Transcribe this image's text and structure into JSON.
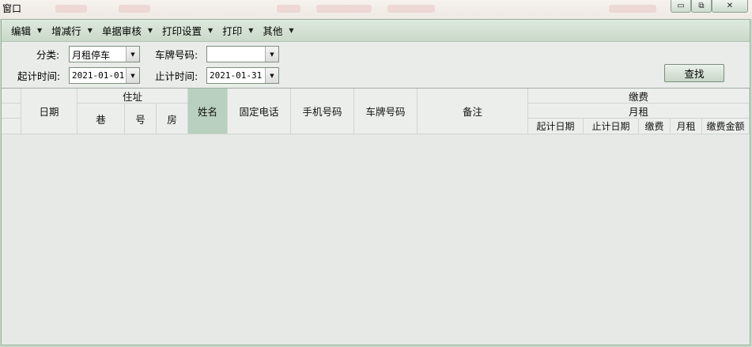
{
  "window": {
    "title": "窗口",
    "minimize_glyph": "▭",
    "restore_glyph": "⧉",
    "close_glyph": "✕"
  },
  "menubar": {
    "items": [
      {
        "label": "编辑",
        "arrow": "▼"
      },
      {
        "label": "增减行",
        "arrow": "▼"
      },
      {
        "label": "单据审核",
        "arrow": "▼"
      },
      {
        "label": "打印设置",
        "arrow": "▼"
      },
      {
        "label": "打印",
        "arrow": "▼"
      },
      {
        "label": "其他",
        "arrow": "▼"
      }
    ]
  },
  "filters": {
    "category_label": "分类:",
    "category_value": "月租停车",
    "plate_label": "车牌号码:",
    "plate_value": "",
    "start_label": "起计时间:",
    "start_value": "2021-01-01",
    "end_label": "止计时间:",
    "end_value": "2021-01-31",
    "search_button": "查找",
    "drop_arrow": "▼"
  },
  "grid": {
    "headers": {
      "date": "日期",
      "address": "住址",
      "lane": "巷",
      "number": "号",
      "room": "房",
      "name": "姓名",
      "landline": "固定电话",
      "mobile": "手机号码",
      "plate": "车牌号码",
      "remark": "备注",
      "payment": "缴费",
      "monthly": "月租",
      "start_date": "起计日期",
      "end_date": "止计日期",
      "pay": "缴费",
      "rent": "月租",
      "amount": "缴费金额"
    },
    "rows": []
  },
  "colors": {
    "accent": "#c9d9c9",
    "selected_header": "#b9cfbf"
  }
}
